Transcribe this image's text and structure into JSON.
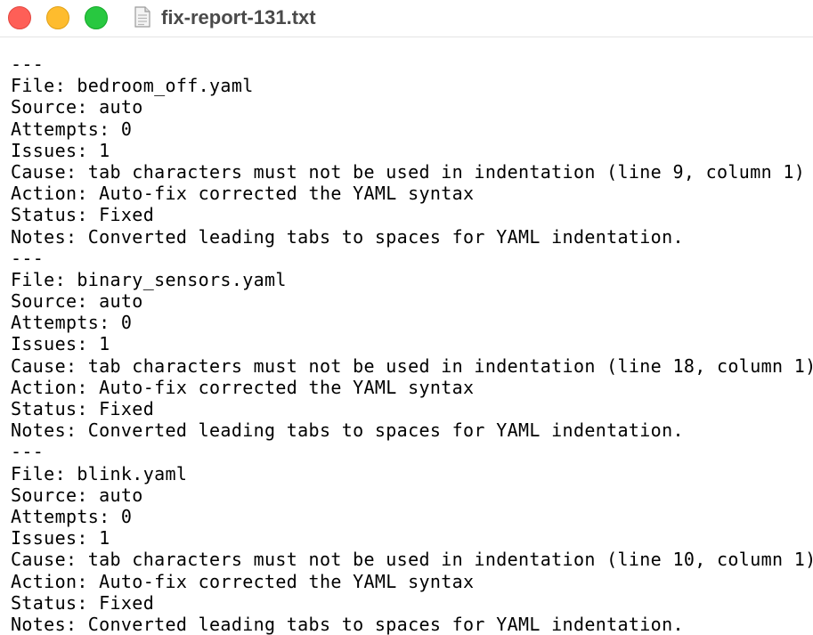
{
  "window": {
    "title": "fix-report-131.txt",
    "doc_icon": "text-document-icon"
  },
  "document": {
    "lines": [
      "---",
      "File: bedroom_off.yaml",
      "Source: auto",
      "Attempts: 0",
      "Issues: 1",
      "Cause: tab characters must not be used in indentation (line 9, column 1)",
      "Action: Auto-fix corrected the YAML syntax",
      "Status: Fixed",
      "Notes: Converted leading tabs to spaces for YAML indentation.",
      "---",
      "File: binary_sensors.yaml",
      "Source: auto",
      "Attempts: 0",
      "Issues: 1",
      "Cause: tab characters must not be used in indentation (line 18, column 1)",
      "Action: Auto-fix corrected the YAML syntax",
      "Status: Fixed",
      "Notes: Converted leading tabs to spaces for YAML indentation.",
      "---",
      "File: blink.yaml",
      "Source: auto",
      "Attempts: 0",
      "Issues: 1",
      "Cause: tab characters must not be used in indentation (line 10, column 1)",
      "Action: Auto-fix corrected the YAML syntax",
      "Status: Fixed",
      "Notes: Converted leading tabs to spaces for YAML indentation."
    ]
  }
}
